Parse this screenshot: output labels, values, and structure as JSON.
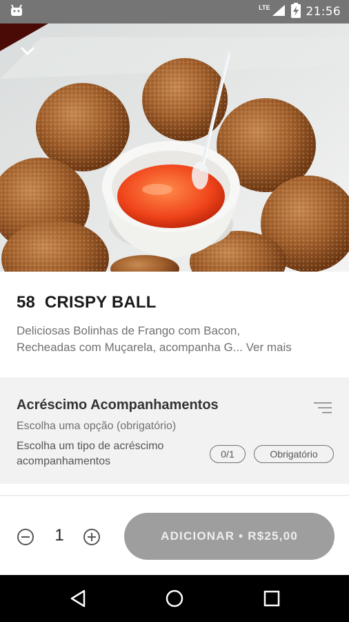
{
  "status_bar": {
    "network": "LTE",
    "time": "21:56",
    "icons": [
      "android-icon",
      "signal-icon",
      "battery-charging-icon"
    ]
  },
  "hero": {
    "image": "crispy-ball-photo"
  },
  "product": {
    "title": "58  CRISPY BALL",
    "description_line1": "Deliciosas Bolinhas de Frango com Bacon,",
    "description_line2": "Recheadas com Muçarela, acompanha G...",
    "see_more": "Ver mais"
  },
  "addon": {
    "title": "Acréscimo Acompanhamentos",
    "subtitle": "Escolha uma opção (obrigatório)",
    "instruction": "Escolha um tipo de acréscimo acompanhamentos",
    "count": "0/1",
    "required_badge": "Obrigatório"
  },
  "action": {
    "quantity": "1",
    "add_label": "ADICIONAR • R$25,00"
  },
  "colors": {
    "status_bar": "#757575",
    "button_disabled": "#9e9e9e",
    "section_bg": "#f2f2f2"
  }
}
